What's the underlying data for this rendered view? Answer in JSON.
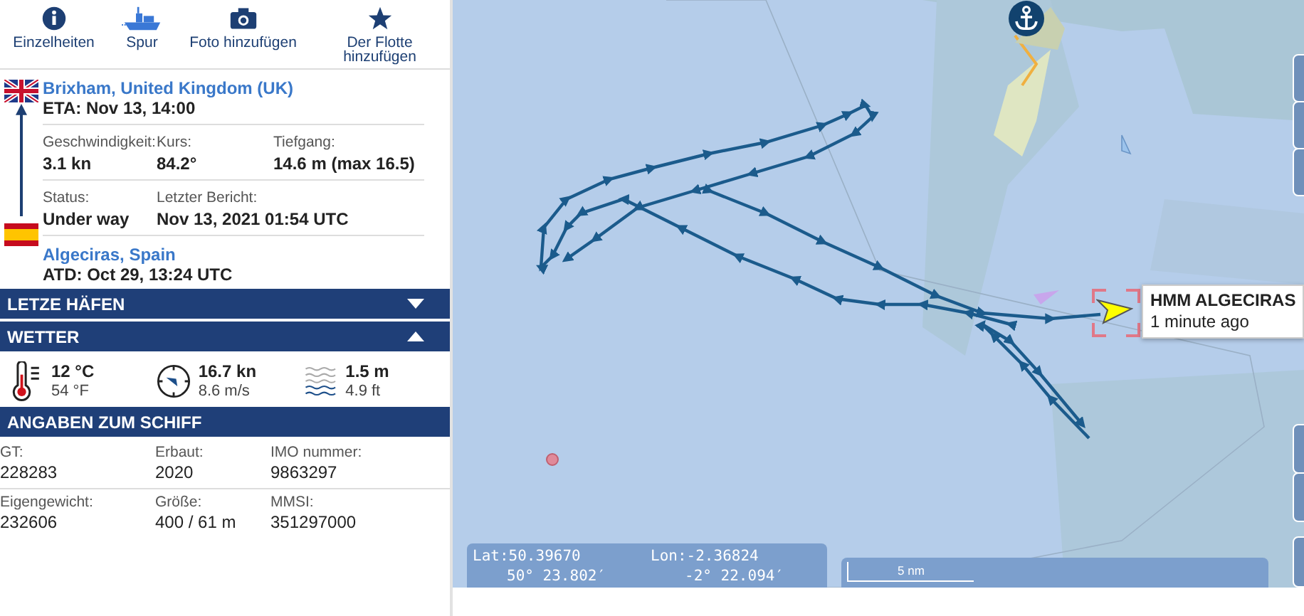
{
  "toolbar": [
    {
      "kind": "info",
      "label": "Einzelheiten"
    },
    {
      "kind": "track",
      "label": "Spur"
    },
    {
      "kind": "camera",
      "label": "Foto hinzufügen"
    },
    {
      "kind": "star",
      "label": "Der Flotte hinzufügen"
    }
  ],
  "destination": {
    "port": "Brixham, United Kingdom (UK)",
    "time": "ETA: Nov 13, 14:00"
  },
  "voyage_stats": [
    [
      {
        "label": "Geschwindigkeit:",
        "value": "3.1 kn"
      },
      {
        "label": "Kurs:",
        "value": "84.2°"
      },
      {
        "label": "Tiefgang:",
        "value": "14.6 m (max 16.5)"
      }
    ],
    [
      {
        "label": "Status:",
        "value": "Under way"
      },
      {
        "label": "Letzter Bericht:",
        "value": "Nov 13, 2021 01:54 UTC"
      }
    ]
  ],
  "origin": {
    "port": "Algeciras, Spain",
    "time": "ATD: Oct 29, 13:24 UTC"
  },
  "sections": [
    {
      "title": "LETZE HÄFEN",
      "expanded": false
    },
    {
      "title": "WETTER",
      "expanded": true
    }
  ],
  "weather": [
    {
      "kind": "temperature",
      "main": "12 °C",
      "sub": "54 °F"
    },
    {
      "kind": "wind",
      "main": "16.7 kn",
      "sub": "8.6 m/s"
    },
    {
      "kind": "waves",
      "main": "1.5 m",
      "sub": "4.9 ft"
    }
  ],
  "ship_details": {
    "title": "ANGABEN ZUM SCHIFF",
    "rows": [
      [
        {
          "label": "GT:",
          "value": "228283"
        },
        {
          "label": "Erbaut:",
          "value": "2020"
        },
        {
          "label": "IMO nummer:",
          "value": "9863297"
        }
      ],
      [
        {
          "label": "Eigengewicht:",
          "value": "232606"
        },
        {
          "label": "Größe:",
          "value": "400 / 61 m"
        },
        {
          "label": "MMSI:",
          "value": "351297000"
        }
      ]
    ]
  },
  "map": {
    "vessel": {
      "name": "HMM ALGECIRAS",
      "time": "1 minute ago"
    },
    "coordinates": {
      "lat": "Lat:50.39670",
      "lon": "Lon:-2.36824",
      "lat_dms": "50° 23.802′",
      "lon_dms": "-2° 22.094′"
    },
    "scale": "5 nm"
  }
}
